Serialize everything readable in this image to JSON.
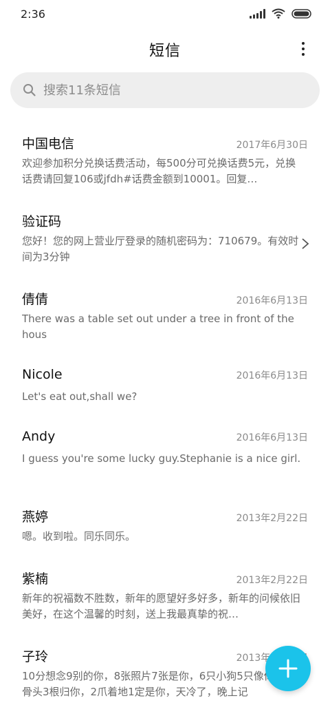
{
  "status_bar": {
    "time": "2:36"
  },
  "header": {
    "title": "短信"
  },
  "search": {
    "placeholder": "搜索11条短信"
  },
  "messages": [
    {
      "sender": "中国电信",
      "date": "2017年6月30日",
      "preview": "欢迎参加积分兑换话费活动，每500分可兑换话费5元，兑换话费请回复106或jfdh#话费金额到10001。回复…"
    },
    {
      "sender": "验证码",
      "date": "",
      "preview": "您好！您的网上营业厅登录的随机密码为：710679。有效时间为3分钟"
    },
    {
      "sender": "倩倩",
      "date": "2016年6月13日",
      "preview": "There was a table set out under a tree in front of the hous"
    },
    {
      "sender": "Nicole",
      "date": "2016年6月13日",
      "preview": "Let's eat out,shall we?"
    },
    {
      "sender": "Andy",
      "date": "2016年6月13日",
      "preview": "I guess you're some lucky guy.Stephanie is a nice girl."
    },
    {
      "sender": "燕婷",
      "date": "2013年2月22日",
      "preview": "嗯。收到啦。同乐同乐。"
    },
    {
      "sender": "紫楠",
      "date": "2013年2月22日",
      "preview": "新年的祝福数不胜数，新年的愿望好多好多，新年的问候依旧美好，在这个温馨的时刻，送上我最真挚的祝…"
    },
    {
      "sender": "子玲",
      "date": "2013年2月22日",
      "preview": "10分想念9别的你，8张照片7张是你，6只小狗5只像你，4根骨头3根归你，2爪着地1定是你，天冷了，晚上记"
    }
  ],
  "colors": {
    "fab": "#1bc3ea",
    "search_bg": "#eeeeee"
  },
  "icons": {
    "fab": "plus-icon",
    "search": "search-icon",
    "more": "more-vertical-icon",
    "chevron": "chevron-right-icon"
  }
}
